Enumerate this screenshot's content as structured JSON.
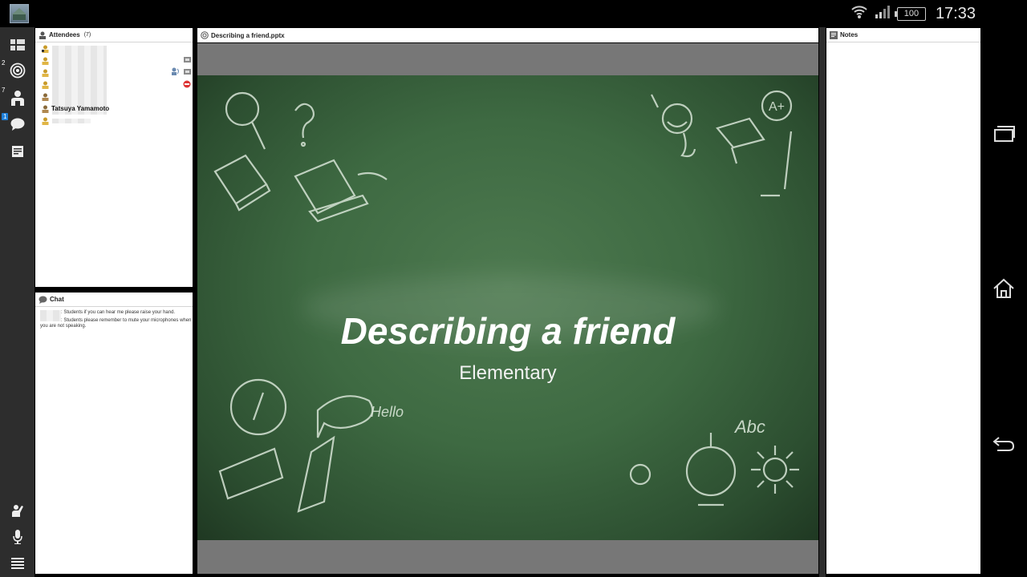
{
  "status": {
    "time": "17:33",
    "battery": "100"
  },
  "toolbar": {
    "badge_polls": "2",
    "badge_attendees": "7",
    "badge_chat": "1"
  },
  "attendees": {
    "title": "Attendees",
    "count": "(7)",
    "named": "Tatsuya Yamamoto"
  },
  "chat": {
    "title": "Chat",
    "messages": [
      ": Students if you can hear me please raise your hand.",
      ": Students please remember to mute your microphones when you are not speaking."
    ]
  },
  "document": {
    "title": "Describing a friend.pptx",
    "slide_title": "Describing a friend",
    "slide_subtitle": "Elementary"
  },
  "notes": {
    "title": "Notes"
  }
}
